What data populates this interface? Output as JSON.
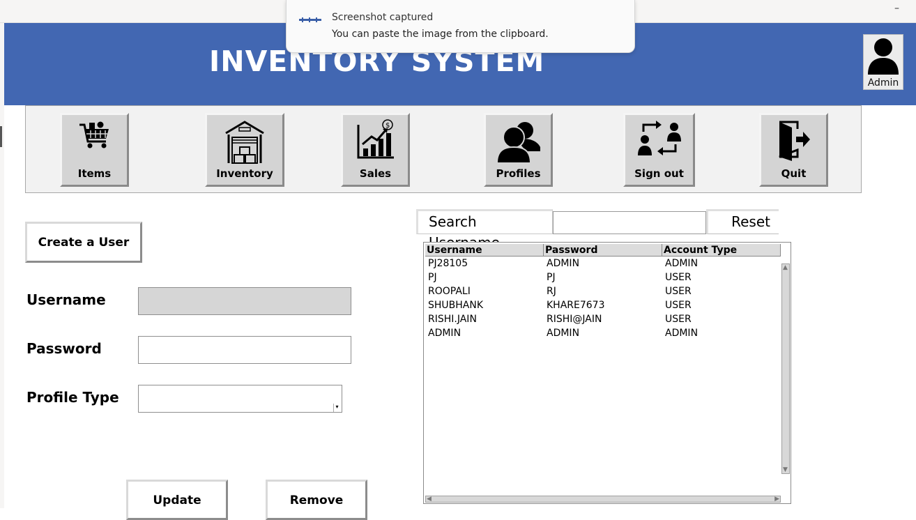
{
  "window": {
    "minimize_glyph": "–"
  },
  "notification": {
    "title": "Screenshot captured",
    "body": "You can paste the image from the clipboard."
  },
  "header": {
    "title": "INVENTORY SYSTEM",
    "background": "#4267b2",
    "user_label": "Admin",
    "user_icon": "user-silhouette-icon"
  },
  "toolbar": {
    "items": [
      {
        "label": "Items",
        "icon": "shopping-cart-icon"
      },
      {
        "label": "Inventory",
        "icon": "warehouse-icon"
      },
      {
        "label": "Sales",
        "icon": "sales-chart-icon"
      },
      {
        "label": "Profiles",
        "icon": "profiles-icon"
      },
      {
        "label": "Sign out",
        "icon": "switch-user-icon"
      },
      {
        "label": "Quit",
        "icon": "exit-door-icon"
      }
    ]
  },
  "form": {
    "create_label": "Create a User",
    "username_label": "Username",
    "username_value": "",
    "password_label": "Password",
    "password_value": "",
    "profile_type_label": "Profile Type",
    "profile_type_value": "",
    "update_label": "Update",
    "remove_label": "Remove"
  },
  "search": {
    "label": "Search Username",
    "value": "",
    "reset_label": "Reset"
  },
  "table": {
    "columns": [
      "Username",
      "Password",
      "Account Type"
    ],
    "rows": [
      [
        "PJ28105",
        "ADMIN",
        "ADMIN"
      ],
      [
        "PJ",
        "PJ",
        "USER"
      ],
      [
        "ROOPALI",
        "RJ",
        "USER"
      ],
      [
        "SHUBHANK",
        "KHARE7673",
        "USER"
      ],
      [
        "RISHI.JAIN",
        "RISHI@JAIN",
        "USER"
      ],
      [
        "ADMIN",
        "ADMIN",
        "ADMIN"
      ]
    ]
  }
}
